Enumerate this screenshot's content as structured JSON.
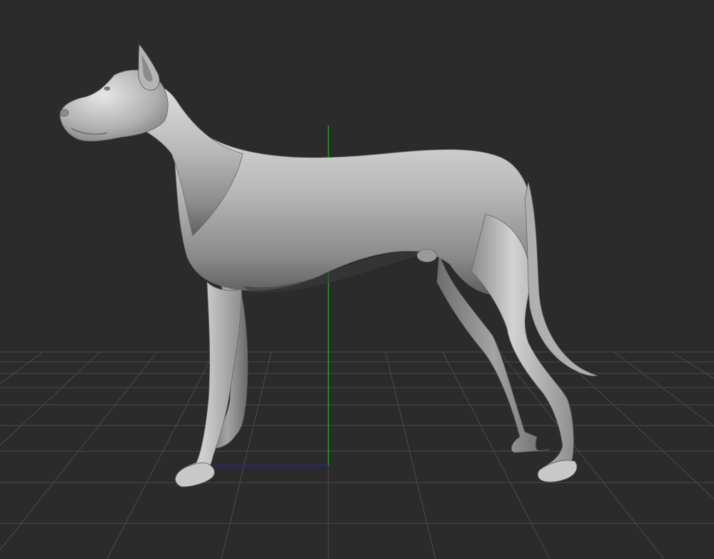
{
  "viewport": {
    "background_color": "#2b2b2b",
    "grid_color": "#4a4a4a",
    "x_axis_color": "#1f1fd6",
    "y_axis_color": "#1fb51f",
    "model_base_color": "#a8a8a8",
    "model_highlight_color": "#dcdcdc",
    "model_shadow_color": "#5a5a5a",
    "model_name": "dog sculpt mesh",
    "grid_visible": true,
    "axes_visible": true
  }
}
